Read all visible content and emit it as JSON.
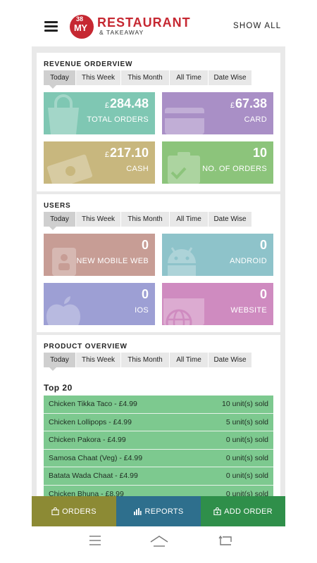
{
  "header": {
    "logo_number": "38",
    "logo_my": "MY",
    "logo_title": "RESTAURANT",
    "logo_subtitle": "& TAKEAWAY",
    "show_all": "SHOW ALL"
  },
  "revenue": {
    "title": "REVENUE ORDERVIEW",
    "tabs": [
      "Today",
      "This Week",
      "This Month",
      "All Time",
      "Date Wise"
    ],
    "active_tab": "Today",
    "tiles": [
      {
        "currency": "£",
        "value": "284.48",
        "label": "TOTAL ORDERS",
        "color": "#7fc7b3",
        "icon": "shopping-bag-icon"
      },
      {
        "currency": "£",
        "value": "67.38",
        "label": "CARD",
        "color": "#a98fc6",
        "icon": "credit-card-icon"
      },
      {
        "currency": "£",
        "value": "217.10",
        "label": "CASH",
        "color": "#c8b77e",
        "icon": "cash-icon"
      },
      {
        "currency": "",
        "value": "10",
        "label": "NO. OF ORDERS",
        "color": "#8cc47b",
        "icon": "clipboard-check-icon"
      }
    ]
  },
  "users": {
    "title": "USERS",
    "tabs": [
      "Today",
      "This Week",
      "This Month",
      "All Time",
      "Date Wise"
    ],
    "active_tab": "Today",
    "tiles": [
      {
        "value": "0",
        "label": "NEW MOBILE WEB",
        "color": "#c79d95",
        "icon": "mobile-user-icon"
      },
      {
        "value": "0",
        "label": "ANDROID",
        "color": "#8ec3ca",
        "icon": "android-icon"
      },
      {
        "value": "0",
        "label": "IOS",
        "color": "#9d9fd4",
        "icon": "apple-icon"
      },
      {
        "value": "0",
        "label": "WEBSITE",
        "color": "#cf8bc0",
        "icon": "globe-icon"
      }
    ]
  },
  "product": {
    "title": "PRODUCT OVERVIEW",
    "tabs": [
      "Today",
      "This Week",
      "This Month",
      "All Time",
      "Date Wise"
    ],
    "active_tab": "Today",
    "list_title": "Top 20",
    "items": [
      {
        "name": "Chicken Tikka Taco - £4.99",
        "sold": "10 unit(s) sold"
      },
      {
        "name": "Chicken Lollipops - £4.99",
        "sold": "5 unit(s) sold"
      },
      {
        "name": "Chicken Pakora - £4.99",
        "sold": "0 unit(s) sold"
      },
      {
        "name": "Samosa Chaat (Veg) - £4.99",
        "sold": "0 unit(s) sold"
      },
      {
        "name": "Batata Wada Chaat - £4.99",
        "sold": "0 unit(s) sold"
      },
      {
        "name": "Chicken Bhuna - £8.99",
        "sold": "0 unit(s) sold"
      }
    ]
  },
  "bottom_nav": {
    "orders": "ORDERS",
    "reports": "REPORTS",
    "add_order": "ADD ORDER"
  }
}
